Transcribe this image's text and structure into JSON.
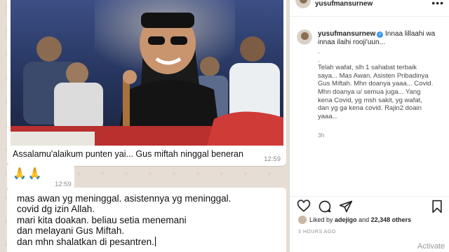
{
  "chat": {
    "photo_caption": "Assalamu'alaikum punten yai... Gus miftah ninggal beneran",
    "time_photo": "12:59",
    "emoji": "🙏🙏",
    "time_emoji": "12:59",
    "message_lines": [
      "mas awan yg meninggal. asistennya yg meninggal.",
      "covid dg izin Allah.",
      "mari kita doakan. beliau setia menemani",
      "dan melayani Gus Miftah.",
      "dan mhn shalatkan di pesantren."
    ]
  },
  "instagram": {
    "header_username": "yusufmansurnew",
    "more_icon": "more-horizontal-icon",
    "caption_username": "yusufmansurnew",
    "caption_first": "Innaa lillaahi wa innaa ilaihi rooji'uun...",
    "caption_lines": [
      ".",
      ".",
      "Telah wafat, slh 1 sahabat terbaik",
      "saya... Mas Awan. Asisten Pribadinya",
      "Gus Miftah. Mhn doanya yaaa... Covid.",
      "Mhn doanya u/ semua juga... Yang",
      "kena Covid, yg msh sakit, yg wafat,",
      "dan yg ga kena covid. Rajin2 doain",
      "yaaa..."
    ],
    "comment_time": "3h",
    "likes_prefix": "Liked by",
    "likes_user": "adejigo",
    "likes_and": "and",
    "likes_count": "22,348 others",
    "posted_ago": "3 HOURS AGO",
    "watermark": "Activate"
  }
}
